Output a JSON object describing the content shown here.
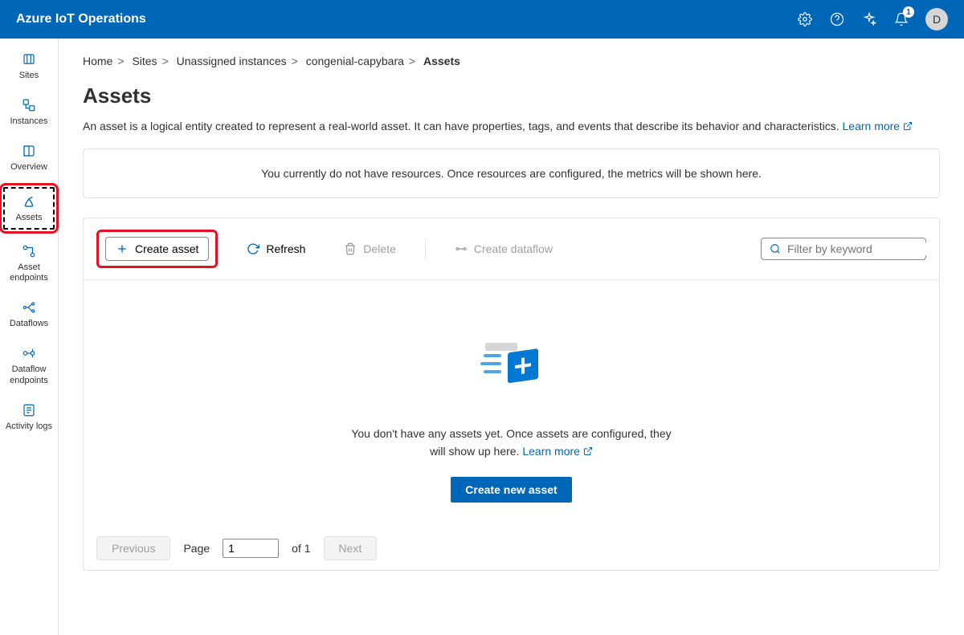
{
  "header": {
    "brand": "Azure IoT Operations",
    "notification_count": "1",
    "avatar_letter": "D"
  },
  "sidebar": {
    "items": [
      {
        "label": "Sites"
      },
      {
        "label": "Instances"
      },
      {
        "label": "Overview"
      },
      {
        "label": "Assets"
      },
      {
        "label": "Asset endpoints"
      },
      {
        "label": "Dataflows"
      },
      {
        "label": "Dataflow endpoints"
      },
      {
        "label": "Activity logs"
      }
    ]
  },
  "breadcrumb": {
    "items": [
      "Home",
      "Sites",
      "Unassigned instances",
      "congenial-capybara"
    ],
    "current": "Assets"
  },
  "page": {
    "title": "Assets",
    "description": "An asset is a logical entity created to represent a real-world asset. It can have properties, tags, and events that describe its behavior and characteristics. ",
    "learn_more": "Learn more",
    "notice": "You currently do not have resources. Once resources are configured, the metrics will be shown here."
  },
  "toolbar": {
    "create_label": "Create asset",
    "refresh_label": "Refresh",
    "delete_label": "Delete",
    "dataflow_label": "Create dataflow",
    "search_placeholder": "Filter by keyword"
  },
  "empty": {
    "text_part1": "You don't have any assets yet. Once assets are configured, they will show up here. ",
    "learn_more": "Learn more",
    "button": "Create new asset"
  },
  "pager": {
    "prev": "Previous",
    "next": "Next",
    "page_label": "Page",
    "page_value": "1",
    "of_label": "of 1"
  }
}
